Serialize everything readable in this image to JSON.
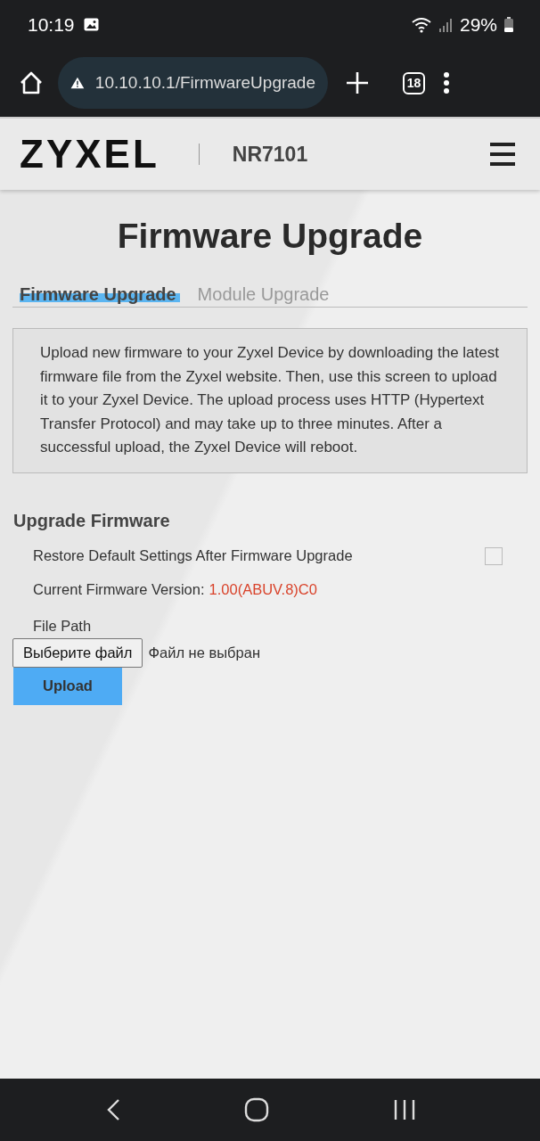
{
  "status_bar": {
    "time": "10:19",
    "battery": "29%"
  },
  "browser": {
    "url": "10.10.10.1/FirmwareUpgrade",
    "tab_count": "18"
  },
  "header": {
    "logo": "ZYXEL",
    "model": "NR7101"
  },
  "page_title": "Firmware Upgrade",
  "tabs": [
    {
      "label": "Firmware Upgrade",
      "selected": true
    },
    {
      "label": "Module Upgrade",
      "selected": false
    }
  ],
  "description": "Upload new firmware to your Zyxel Device by downloading the latest firmware file from the Zyxel website. Then, use this screen to upload it to your Zyxel Device. The upload process uses HTTP (Hypertext Transfer Protocol) and may take up to three minutes. After a successful upload, the Zyxel Device will reboot.",
  "section": {
    "title": "Upgrade Firmware",
    "restore_option": {
      "label": "Restore Default Settings After Firmware Upgrade",
      "checked": false
    },
    "version_label": "Current Firmware Version:",
    "version_value": "1.00(ABUV.8)C0",
    "file_path_label": "File Path",
    "choose_file_button": "Выберите файл",
    "file_status": "Файл не выбран",
    "upload_button": "Upload"
  }
}
